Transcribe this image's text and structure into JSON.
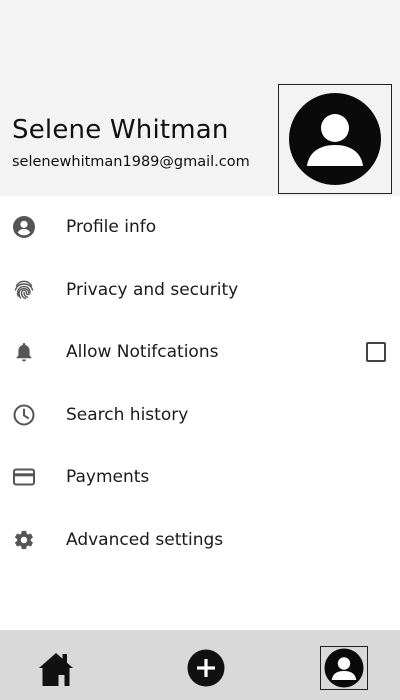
{
  "profile": {
    "name": "Selene Whitman",
    "email": "selenewhitman1989@gmail.com",
    "avatar_icon": "person-avatar-icon"
  },
  "menu": {
    "items": [
      {
        "label": "Profile info",
        "icon": "account-circle-icon"
      },
      {
        "label": "Privacy and security",
        "icon": "fingerprint-icon"
      },
      {
        "label": "Allow Notifcations",
        "icon": "bell-icon",
        "checkbox_checked": false
      },
      {
        "label": "Search history",
        "icon": "clock-icon"
      },
      {
        "label": "Payments",
        "icon": "credit-card-icon"
      },
      {
        "label": "Advanced settings",
        "icon": "gear-icon"
      }
    ]
  },
  "bottom_nav": {
    "items": [
      {
        "icon": "home-icon"
      },
      {
        "icon": "add-circle-icon"
      },
      {
        "icon": "profile-avatar-icon",
        "selected": true
      }
    ]
  },
  "colors": {
    "header_bg": "#f3f3f3",
    "bottom_bar_bg": "#d9d9d9",
    "icon_color": "#555555",
    "text": "#111111"
  }
}
